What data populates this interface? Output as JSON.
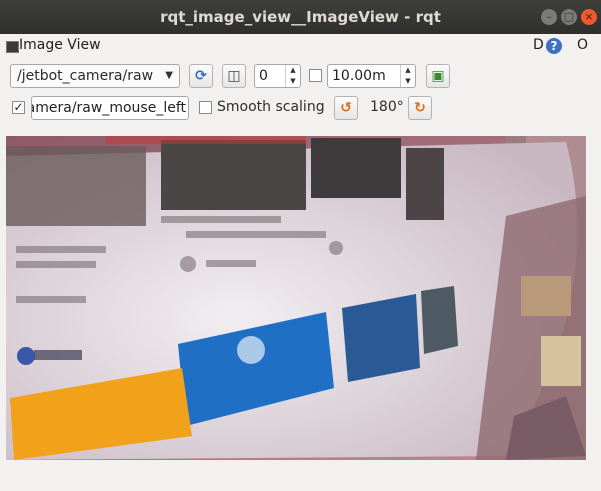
{
  "window": {
    "title": "rqt_image_view__ImageView - rqt"
  },
  "dock": {
    "title": "Image View",
    "d_label": "D",
    "help_label": "?",
    "o_label": "O"
  },
  "toolbar": {
    "topic": "/jetbot_camera/raw",
    "spin_value": "0",
    "max_range": "10.00m",
    "mouse_topic": "amera/raw_mouse_left",
    "smooth_label": "Smooth scaling",
    "rotation": "180°",
    "publish_checked": "✓"
  },
  "image": {
    "colors": {
      "screen": "#e7e2e6",
      "blue_card": "#1f6fc4",
      "orange_card": "#f2a11a",
      "wall": "#a66a76"
    }
  }
}
